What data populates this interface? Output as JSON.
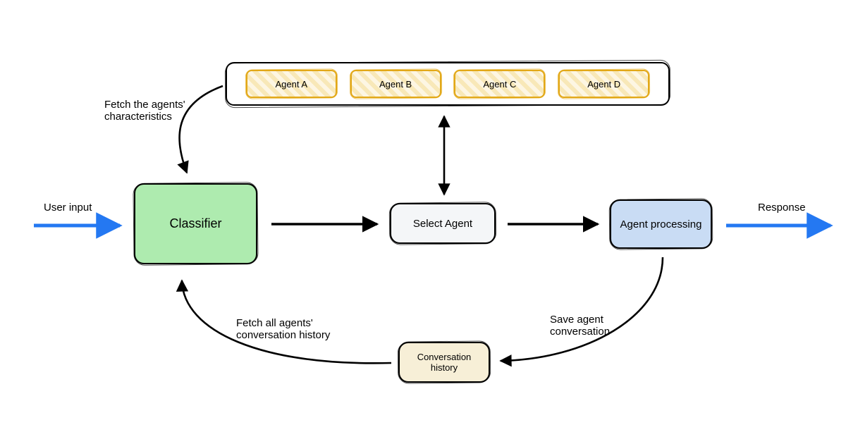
{
  "nodes": {
    "classifier": "Classifier",
    "select_agent": "Select Agent",
    "agent_processing": "Agent\nprocessing",
    "conversation_history": "Conversation\nhistory"
  },
  "agents_container": {
    "items": [
      "Agent A",
      "Agent B",
      "Agent C",
      "Agent D"
    ]
  },
  "labels": {
    "user_input": "User input",
    "response": "Response",
    "fetch_characteristics": "Fetch the agents'\ncharacteristics",
    "fetch_history": "Fetch all agents'\nconversation history",
    "save_conversation": "Save agent\nconversation"
  },
  "colors": {
    "classifier_bg": "#AEEBAF",
    "select_agent_bg": "#F4F6F8",
    "agent_processing_bg": "#C9DCF4",
    "conversation_history_bg": "#f7efd7",
    "agent_border": "#E2A817",
    "io_arrow": "#2478F2",
    "flow_arrow": "#000000"
  }
}
